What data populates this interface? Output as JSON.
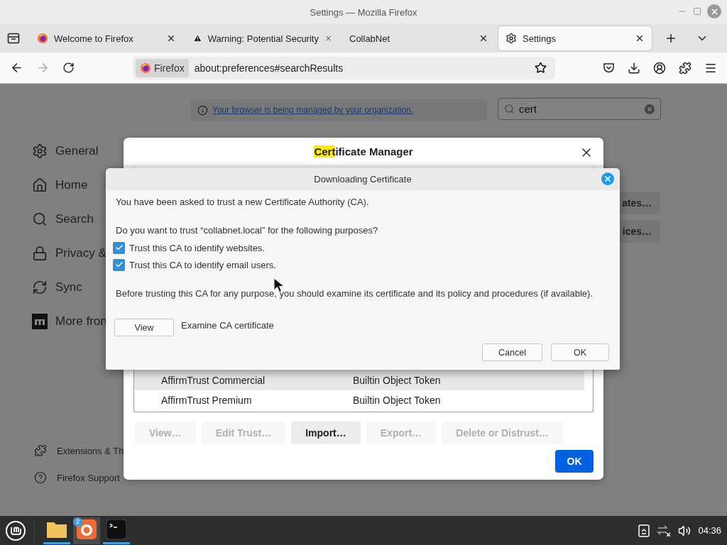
{
  "window": {
    "title": "Settings — Mozilla Firefox"
  },
  "tabs": [
    {
      "label": "Welcome to Firefox",
      "kind": "firefox",
      "selected": false
    },
    {
      "label": "Warning: Potential Security",
      "kind": "warning",
      "selected": false
    },
    {
      "label": "CollabNet",
      "kind": "plain",
      "selected": false
    },
    {
      "label": "Settings",
      "kind": "gear",
      "selected": true
    }
  ],
  "nav_buttons": [
    {
      "kind": "back",
      "disabled": false
    },
    {
      "kind": "forward",
      "disabled": true
    },
    {
      "kind": "reload",
      "disabled": false
    }
  ],
  "address_bar": {
    "identity": "Firefox",
    "url": "about:preferences#searchResults"
  },
  "settings": {
    "notice": "Your browser is being managed by your organization.",
    "search": {
      "value": "cert"
    },
    "sidebar": [
      {
        "label": "General",
        "kind": "gear"
      },
      {
        "label": "Home",
        "kind": "home"
      },
      {
        "label": "Search",
        "kind": "search"
      },
      {
        "label": "Privacy &",
        "kind": "lock"
      },
      {
        "label": "Sync",
        "kind": "sync"
      },
      {
        "label": "More fron",
        "kind": "mozilla"
      }
    ],
    "footer": [
      {
        "label": "Extensions & Th",
        "kind": "puzzle"
      },
      {
        "label": "Firefox Support",
        "kind": "help"
      }
    ],
    "partial_buttons": [
      "ates…",
      "ices…"
    ]
  },
  "certificate_manager": {
    "title_match": "Cert",
    "title_rest": "ificate Manager",
    "rows": [
      {
        "cells": [
          "AffirmTrust Commercial",
          "Builtin Object Token"
        ],
        "selected": true
      },
      {
        "cells": [
          "AffirmTrust Premium",
          "Builtin Object Token"
        ],
        "selected": false
      }
    ],
    "buttons": [
      {
        "label": "View…",
        "disabled": true
      },
      {
        "label": "Edit Trust…",
        "disabled": true
      },
      {
        "label": "Import…",
        "disabled": false
      },
      {
        "label": "Export…",
        "disabled": true
      },
      {
        "label": "Delete or Distrust…",
        "disabled": true
      }
    ],
    "ok": "OK"
  },
  "download_dialog": {
    "title": "Downloading Certificate",
    "intro": "You have been asked to trust a new Certificate Authority (CA).",
    "question": "Do you want to trust “collabnet.local” for the following purposes?",
    "options": [
      {
        "label": "Trust this CA to identify websites.",
        "checked": true
      },
      {
        "label": "Trust this CA to identify email users.",
        "checked": true
      }
    ],
    "advice": "Before trusting this CA for any purpose, you should examine its certificate and its policy and procedures (if available).",
    "view_button": "View",
    "view_label": "Examine CA certificate",
    "buttons": [
      "Cancel",
      "OK"
    ]
  },
  "taskbar": {
    "apps": [
      {
        "kind": "folder",
        "selected": false,
        "running": true
      },
      {
        "kind": "firefox",
        "selected": true,
        "running": false,
        "badge": "2"
      },
      {
        "kind": "terminal",
        "selected": false,
        "running": true
      }
    ],
    "clock": "04:36"
  }
}
